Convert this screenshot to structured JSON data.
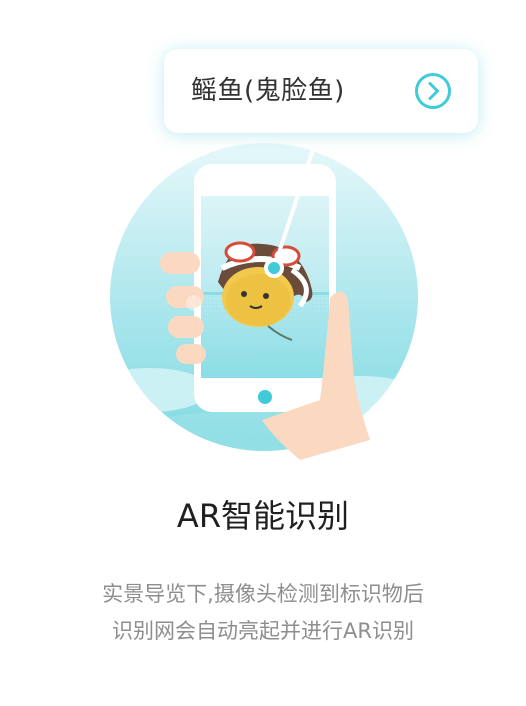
{
  "recognition_label": {
    "text": "鳐鱼(鬼脸鱼)",
    "detail_icon": "chevron-right-circle-icon"
  },
  "feature": {
    "title": "AR智能识别",
    "description_lines": [
      "实景导览下,摄像头检测到标识物后",
      "识别网会自动亮起并进行AR识别"
    ]
  },
  "colors": {
    "accent": "#3fcbd8",
    "circle_background": "#bfeef2",
    "title_text": "#1f1f1f",
    "description_text": "#8e8e8e"
  }
}
